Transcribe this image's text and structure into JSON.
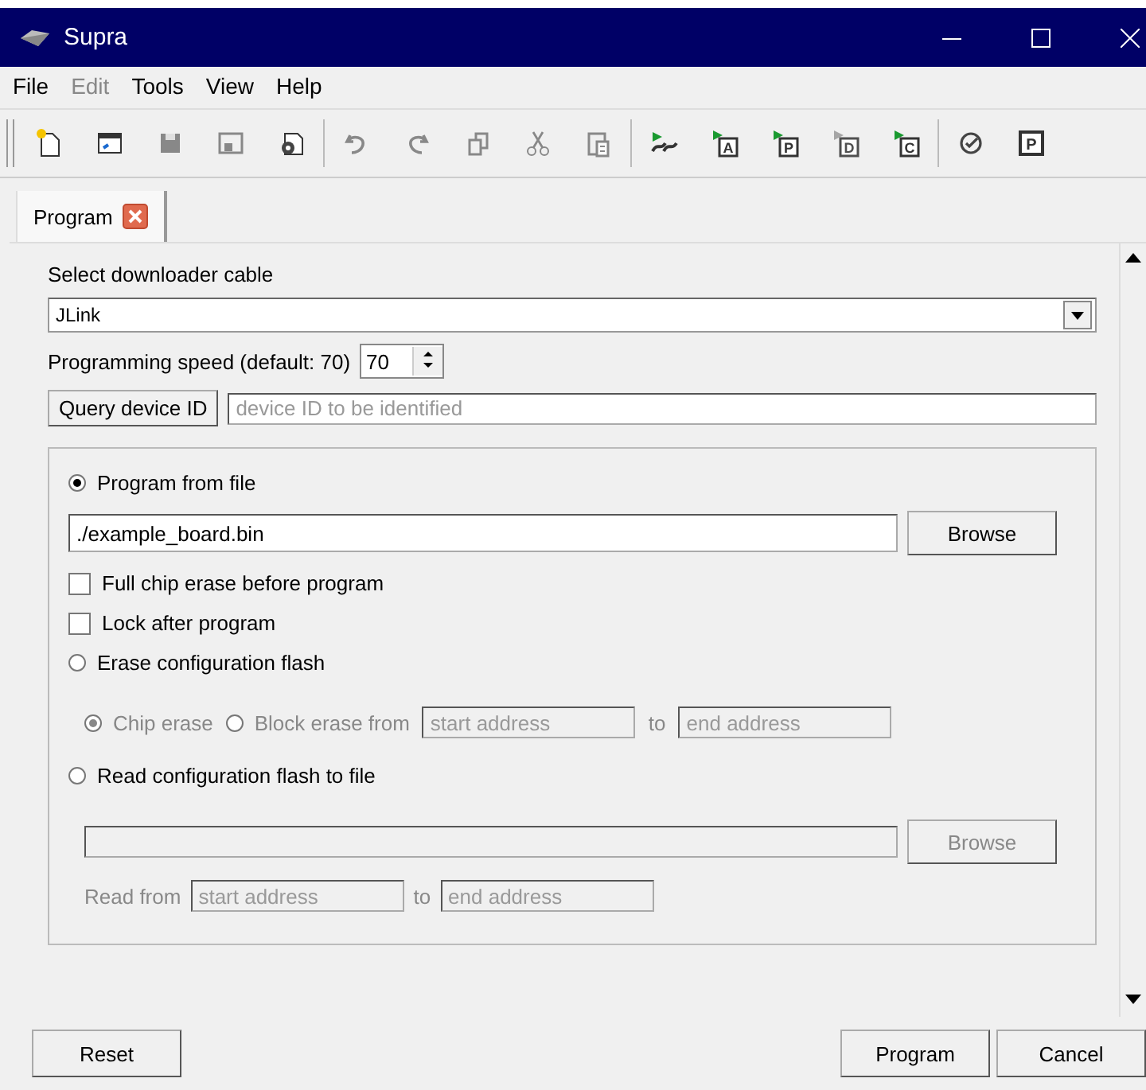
{
  "window": {
    "title": "Supra"
  },
  "menu": [
    {
      "label": "File",
      "disabled": false
    },
    {
      "label": "Edit",
      "disabled": true
    },
    {
      "label": "Tools",
      "disabled": false
    },
    {
      "label": "View",
      "disabled": false
    },
    {
      "label": "Help",
      "disabled": false
    }
  ],
  "toolbar": [
    {
      "kind": "new",
      "disabled": false
    },
    {
      "kind": "open",
      "disabled": false
    },
    {
      "kind": "save",
      "disabled": true
    },
    {
      "kind": "saveas",
      "disabled": true
    },
    {
      "kind": "settings",
      "disabled": false
    },
    {
      "kind": "sep"
    },
    {
      "kind": "undo",
      "disabled": true
    },
    {
      "kind": "redo",
      "disabled": true
    },
    {
      "kind": "copy",
      "disabled": true
    },
    {
      "kind": "cut",
      "disabled": true
    },
    {
      "kind": "paste",
      "disabled": true
    },
    {
      "kind": "sep"
    },
    {
      "kind": "run",
      "disabled": false
    },
    {
      "kind": "runbox",
      "glyph": "A",
      "disabled": false
    },
    {
      "kind": "runbox",
      "glyph": "P",
      "disabled": false
    },
    {
      "kind": "runbox",
      "glyph": "D",
      "disabled": true
    },
    {
      "kind": "runbox",
      "glyph": "C",
      "disabled": false
    },
    {
      "kind": "sep"
    },
    {
      "kind": "verify",
      "disabled": false
    },
    {
      "kind": "box",
      "glyph": "P",
      "disabled": false
    }
  ],
  "tabs": [
    {
      "label": "Program",
      "selected": true
    }
  ],
  "cable": {
    "label": "Select downloader cable",
    "value": "JLink"
  },
  "speed": {
    "label": "Programming speed (default: 70)",
    "value": "70"
  },
  "query": {
    "button": "Query device ID",
    "placeholder": "device ID to be identified"
  },
  "group": {
    "program_file": {
      "label": "Program from file",
      "selected": true,
      "path": "./example_board.bin",
      "browse": "Browse"
    },
    "checks": [
      {
        "label": "Full chip erase before program",
        "checked": false
      },
      {
        "label": "Lock after program",
        "checked": false
      }
    ],
    "erase": {
      "label": "Erase configuration flash",
      "selected": false,
      "disabled": true,
      "modes": [
        {
          "label": "Chip erase",
          "selected": true
        },
        {
          "label": "Block erase from",
          "selected": false
        }
      ],
      "start_placeholder": "start address",
      "to": "to",
      "end_placeholder": "end address"
    },
    "read": {
      "label": "Read configuration flash to file",
      "selected": false,
      "disabled": true,
      "browse": "Browse",
      "from": "Read from",
      "start_placeholder": "start address",
      "to": "to",
      "end_placeholder": "end address"
    }
  },
  "buttons": {
    "reset": "Reset",
    "program": "Program",
    "cancel": "Cancel"
  }
}
